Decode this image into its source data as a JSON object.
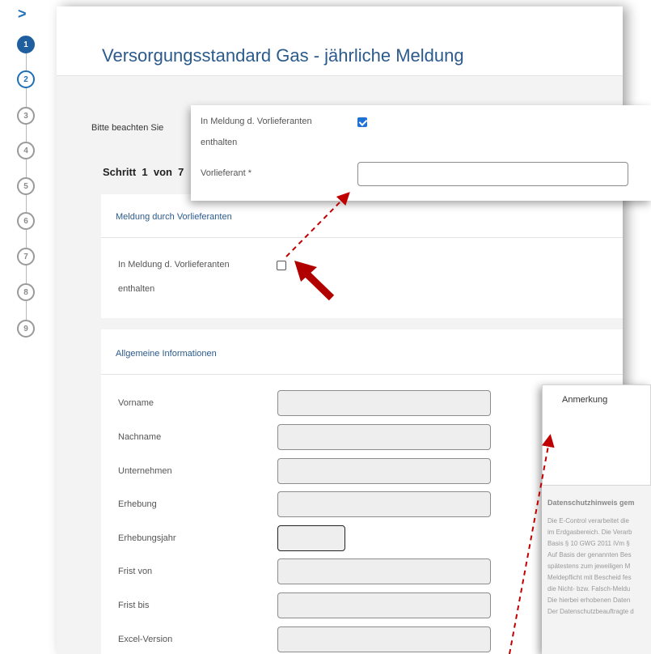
{
  "stepper": {
    "toggle_glyph": ">",
    "steps": [
      "1",
      "2",
      "3",
      "4",
      "5",
      "6",
      "7",
      "8",
      "9"
    ]
  },
  "header": {
    "title": "Versorgungsstandard Gas - jährliche Meldung"
  },
  "intro": {
    "note": "Bitte beachten Sie",
    "step_of": "Schritt  1  von  7"
  },
  "card_supplier": {
    "title": "Meldung durch Vorlieferanten",
    "checkbox_label_line1": "In Meldung d. Vorlieferanten",
    "checkbox_label_line2": "enthalten",
    "checked": false
  },
  "popup_top": {
    "checkbox_label_line1": "In Meldung d. Vorlieferanten",
    "checkbox_label_line2": "enthalten",
    "checked": true,
    "supplier_label": "Vorlieferant *",
    "supplier_value": ""
  },
  "card_general": {
    "title": "Allgemeine Informationen",
    "fields": [
      {
        "label": "Vorname",
        "value": ""
      },
      {
        "label": "Nachname",
        "value": ""
      },
      {
        "label": "Unternehmen",
        "value": ""
      },
      {
        "label": "Erhebung",
        "value": ""
      },
      {
        "label": "Erhebungsjahr",
        "value": ""
      },
      {
        "label": "Frist von",
        "value": ""
      },
      {
        "label": "Frist bis",
        "value": ""
      },
      {
        "label": "Excel-Version",
        "value": ""
      }
    ]
  },
  "popup_bottom": {
    "anmerkung_label": "Anmerkung",
    "datenschutz_title": "Datenschutzhinweis gem",
    "datenschutz_lines": [
      "Die E-Control verarbeitet die",
      "im Erdgasbereich. Die Verarb",
      "Basis § 10 GWG 2011 iVm §",
      "Auf Basis der genannten Bes",
      "spätestens zum jeweiligen M",
      "Meldepflicht mit Bescheid fes",
      "die Nicht- bzw. Falsch-Meldu",
      "Die hierbei erhobenen Daten",
      "Der Datenschutzbeauftragte d"
    ]
  },
  "colors": {
    "accent": "#2b5a8c",
    "step_active": "#1f5fa0",
    "checkbox_checked": "#1e72d6",
    "annotation_red": "#c00000"
  }
}
